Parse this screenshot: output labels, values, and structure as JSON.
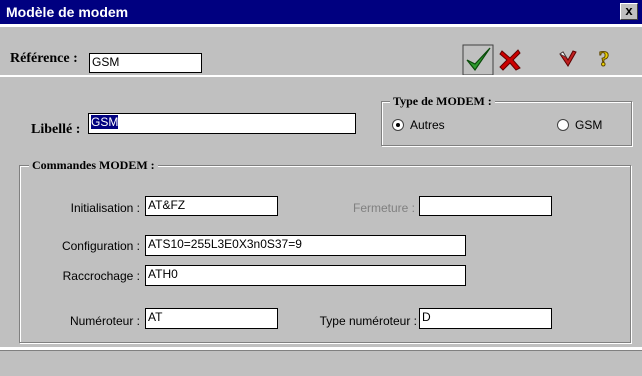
{
  "window": {
    "title": "Modèle de modem",
    "close_glyph": "x"
  },
  "toolbar": {
    "reference_label": "Référence :",
    "reference_value": "GSM",
    "icons": [
      "check-icon",
      "cancel-x-icon",
      "eraser-icon",
      "help-question-icon"
    ],
    "help_glyph": "?"
  },
  "form": {
    "libelle_label": "Libellé :",
    "libelle_value": "GSM",
    "modem_type": {
      "legend": "Type de MODEM :",
      "options": [
        "Autres",
        "GSM"
      ],
      "selected": "Autres"
    },
    "commands": {
      "legend": "Commandes MODEM :",
      "initialisation_label": "Initialisation :",
      "initialisation_value": "AT&FZ",
      "fermeture_label": "Fermeture :",
      "fermeture_value": "",
      "configuration_label": "Configuration :",
      "configuration_value": "ATS10=255L3E0X3n0S37=9",
      "raccrochage_label": "Raccrochage :",
      "raccrochage_value": "ATH0",
      "numeroteur_label": "Numéroteur :",
      "numeroteur_value": "AT",
      "type_numeroteur_label": "Type numéroteur :",
      "type_numeroteur_value": "D"
    }
  },
  "colors": {
    "titlebar": "#000080",
    "dialog": "#c0c0c0",
    "check": "#2e9a2e",
    "cancel": "#cc0000",
    "help": "#e8d000"
  }
}
